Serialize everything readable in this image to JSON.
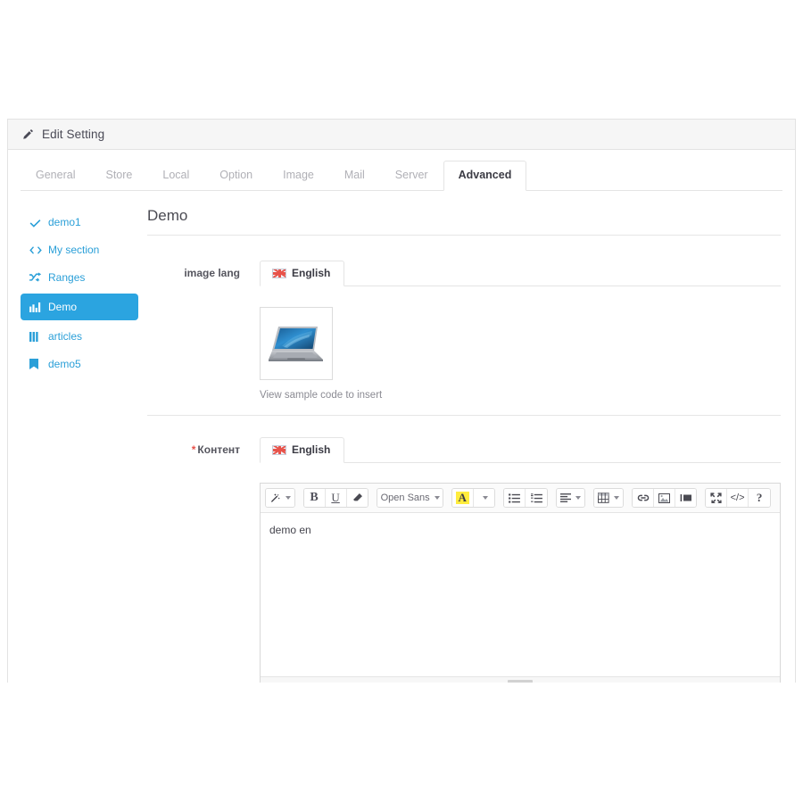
{
  "header": {
    "title": "Edit Setting",
    "icon": "pencil-icon"
  },
  "tabs": [
    {
      "label": "General",
      "active": false
    },
    {
      "label": "Store",
      "active": false
    },
    {
      "label": "Local",
      "active": false
    },
    {
      "label": "Option",
      "active": false
    },
    {
      "label": "Image",
      "active": false
    },
    {
      "label": "Mail",
      "active": false
    },
    {
      "label": "Server",
      "active": false
    },
    {
      "label": "Advanced",
      "active": true
    }
  ],
  "sidebar": {
    "items": [
      {
        "label": "demo1",
        "icon": "check-icon",
        "active": false
      },
      {
        "label": "My section",
        "icon": "code-icon",
        "active": false
      },
      {
        "label": "Ranges",
        "icon": "shuffle-icon",
        "active": false
      },
      {
        "label": "Demo",
        "icon": "bar-chart-icon",
        "active": true
      },
      {
        "label": "articles",
        "icon": "columns-icon",
        "active": false
      },
      {
        "label": "demo5",
        "icon": "bookmark-icon",
        "active": false
      }
    ],
    "active_color": "#2ba4e0",
    "link_color": "#2a9fd8"
  },
  "main": {
    "section_title": "Demo",
    "rows": [
      {
        "label": "image lang",
        "required": false,
        "lang_tab": "English",
        "thumb_caption": "View sample code to insert"
      },
      {
        "label": "Контент",
        "required": true,
        "required_marker": "*",
        "lang_tab": "English"
      }
    ]
  },
  "editor": {
    "font_name": "Open Sans",
    "content": "demo en",
    "highlight_color": "#ffec3d",
    "toolbar": [
      {
        "name": "magic-wand-tool",
        "glyph": "wand",
        "caret": true
      },
      {
        "name": "bold-button",
        "glyph": "B",
        "caret": false
      },
      {
        "name": "underline-button",
        "glyph": "U",
        "caret": false
      },
      {
        "name": "clear-format-button",
        "glyph": "eraser",
        "caret": false
      },
      {
        "name": "font-family-select",
        "glyph": "Open Sans",
        "caret": true
      },
      {
        "name": "text-color-button",
        "glyph": "A",
        "caret": false
      },
      {
        "name": "text-color-caret",
        "glyph": "",
        "caret": true
      },
      {
        "name": "unordered-list-button",
        "glyph": "ul",
        "caret": false
      },
      {
        "name": "ordered-list-button",
        "glyph": "ol",
        "caret": false
      },
      {
        "name": "align-button",
        "glyph": "align",
        "caret": true
      },
      {
        "name": "table-button",
        "glyph": "table",
        "caret": true
      },
      {
        "name": "insert-link-button",
        "glyph": "link",
        "caret": false
      },
      {
        "name": "insert-image-button",
        "glyph": "image",
        "caret": false
      },
      {
        "name": "insert-video-button",
        "glyph": "video",
        "caret": false
      },
      {
        "name": "fullscreen-button",
        "glyph": "fullscreen",
        "caret": false
      },
      {
        "name": "code-view-button",
        "glyph": "</>",
        "caret": false
      },
      {
        "name": "help-button",
        "glyph": "?",
        "caret": false
      }
    ]
  }
}
